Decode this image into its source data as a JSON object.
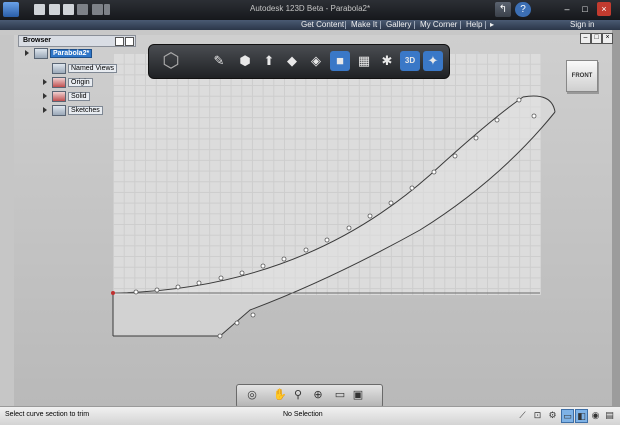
{
  "window": {
    "title": "Autodesk 123D Beta - Parabola2*"
  },
  "menu": {
    "items": [
      "Get Content",
      "Make It",
      "Gallery",
      "My Corner",
      "Help"
    ],
    "more_arrow": "▸",
    "sign_in": "Sign in"
  },
  "icons": {
    "app": "123d-logo-icon",
    "new": "new-file-icon",
    "open": "open-folder-icon",
    "save": "save-icon",
    "undo": "undo-icon",
    "redo": "redo-icon",
    "dropdown": "chevron-down-icon",
    "back": "back-arrow-icon",
    "help": "help-icon",
    "minimize": "minimize-icon",
    "maximize": "maximize-icon",
    "close": "close-icon"
  },
  "browser": {
    "title": "Browser",
    "root": "Parabola2*",
    "nodes": [
      "Named Views",
      "Origin",
      "Solid",
      "Sketches"
    ]
  },
  "ribbon": {
    "tools": [
      "view-cube-menu-icon",
      "pencil-sketch-icon",
      "primitive-box-icon",
      "extrude-icon",
      "modify-icon",
      "pattern-icon",
      "group-icon",
      "combine-icon",
      "snap-icon",
      "text-3d-icon",
      "materials-icon"
    ],
    "text_3d_label": "3D"
  },
  "viewcube": {
    "face_label": "FRONT"
  },
  "navbar": {
    "tools": [
      "orbit-icon",
      "pan-icon",
      "zoom-icon",
      "fit-icon",
      "view-mode-icon",
      "visual-style-icon"
    ]
  },
  "status": {
    "message": "Select curve section to trim",
    "selection": "No Selection"
  },
  "colors": {
    "menu_bar": "#2b3649",
    "canvas": "#c8c8c8",
    "grid_plane": "#dcdcdc",
    "root_highlight": "#2f76c8",
    "curve": "#3a3a3a",
    "origin_point": "#c03030"
  }
}
